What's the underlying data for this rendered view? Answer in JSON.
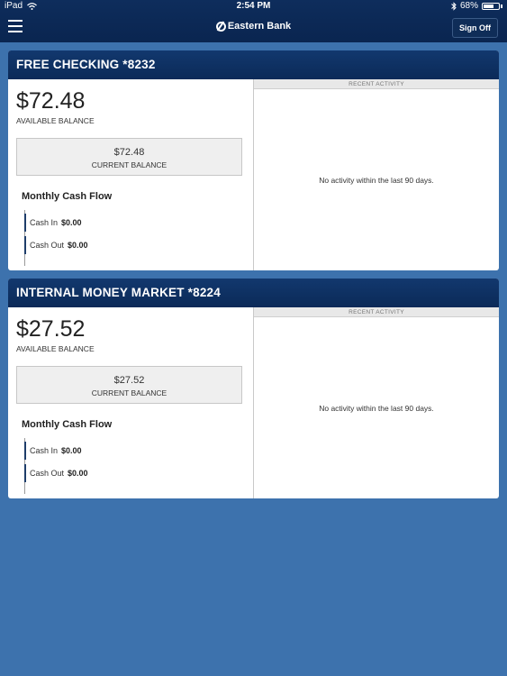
{
  "status_bar": {
    "device": "iPad",
    "wifi_icon": "wifi-icon",
    "time": "2:54 PM",
    "bluetooth_icon": "bluetooth-icon",
    "battery_percent": "68%",
    "battery_level": 0.68
  },
  "header": {
    "menu_icon": "hamburger-menu-icon",
    "brand": "Eastern Bank",
    "sign_off_label": "Sign Off"
  },
  "accounts": [
    {
      "name": "FREE CHECKING *8232",
      "available_balance": "$72.48",
      "available_label": "AVAILABLE BALANCE",
      "current_balance": "$72.48",
      "current_label": "CURRENT BALANCE",
      "cash_flow_title": "Monthly Cash Flow",
      "cash_in_label": "Cash In",
      "cash_in_value": "$0.00",
      "cash_out_label": "Cash Out",
      "cash_out_value": "$0.00",
      "recent_activity_label": "RECENT ACTIVITY",
      "no_activity_text": "No activity within the last 90 days."
    },
    {
      "name": "INTERNAL MONEY MARKET *8224",
      "available_balance": "$27.52",
      "available_label": "AVAILABLE BALANCE",
      "current_balance": "$27.52",
      "current_label": "CURRENT BALANCE",
      "cash_flow_title": "Monthly Cash Flow",
      "cash_in_label": "Cash In",
      "cash_in_value": "$0.00",
      "cash_out_label": "Cash Out",
      "cash_out_value": "$0.00",
      "recent_activity_label": "RECENT ACTIVITY",
      "no_activity_text": "No activity within the last 90 days."
    }
  ],
  "colors": {
    "background": "#3d72ad",
    "header": "#0b2a58",
    "panel": "#ffffff"
  }
}
